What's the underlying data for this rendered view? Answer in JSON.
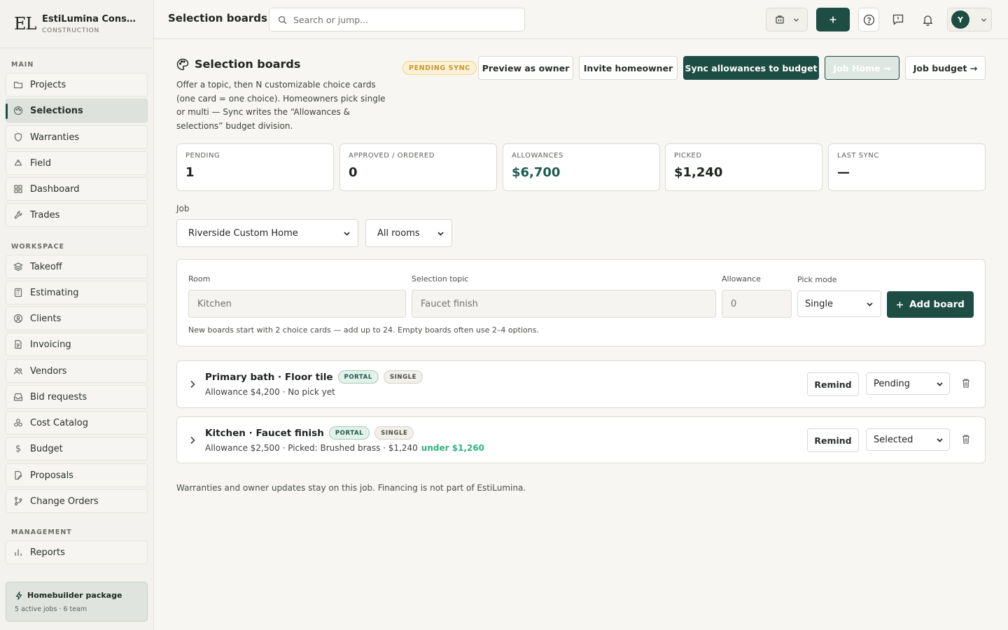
{
  "brand": {
    "mark": "EL",
    "name": "EstiLumina Constru...",
    "sub": "CONSTRUCTION"
  },
  "sidebar": {
    "sections": {
      "main": "MAIN",
      "workspace": "WORKSPACE",
      "management": "MANAGEMENT"
    },
    "items": [
      {
        "label": "Projects",
        "icon": "folder-icon"
      },
      {
        "label": "Selections",
        "icon": "palette-icon",
        "active": true
      },
      {
        "label": "Warranties",
        "icon": "shield-icon"
      },
      {
        "label": "Field",
        "icon": "hardhat-icon"
      },
      {
        "label": "Dashboard",
        "icon": "grid-icon"
      },
      {
        "label": "Trades",
        "icon": "wrench-icon"
      },
      {
        "label": "Takeoff",
        "icon": "layers-icon"
      },
      {
        "label": "Estimating",
        "icon": "calculator-icon"
      },
      {
        "label": "Clients",
        "icon": "user-circle-icon"
      },
      {
        "label": "Invoicing",
        "icon": "document-icon"
      },
      {
        "label": "Vendors",
        "icon": "users-icon"
      },
      {
        "label": "Bid requests",
        "icon": "inbox-icon"
      },
      {
        "label": "Cost Catalog",
        "icon": "boxes-icon"
      },
      {
        "label": "Budget",
        "icon": "dollar-icon"
      },
      {
        "label": "Proposals",
        "icon": "file-edit-icon"
      },
      {
        "label": "Change Orders",
        "icon": "git-branch-icon"
      },
      {
        "label": "Reports",
        "icon": "bar-chart-icon"
      }
    ],
    "package": {
      "title": "Homebuilder package",
      "sub": "5 active jobs · 6 team"
    }
  },
  "topbar": {
    "title": "Selection boards",
    "search_placeholder": "Search or jump...",
    "avatar_initial": "Y"
  },
  "page": {
    "title": "Selection boards",
    "description": "Offer a topic, then N customizable choice cards (one card = one choice). Homeowners pick single or multi — Sync writes the “Allowances & selections” budget division.",
    "sync_badge": "PENDING SYNC",
    "buttons": {
      "preview": "Preview as owner",
      "invite": "Invite homeowner",
      "sync": "Sync allowances to budget",
      "job_home": "Job Home →",
      "job_budget": "Job budget →"
    }
  },
  "stats": [
    {
      "label": "PENDING",
      "value": "1"
    },
    {
      "label": "APPROVED / ORDERED",
      "value": "0"
    },
    {
      "label": "ALLOWANCES",
      "value": "$6,700"
    },
    {
      "label": "PICKED",
      "value": "$1,240"
    },
    {
      "label": "LAST SYNC",
      "value": "—"
    }
  ],
  "filters": {
    "job_label": "Job",
    "job_value": "Riverside Custom Home",
    "room_value": "All rooms"
  },
  "form": {
    "room_label": "Room",
    "room_placeholder": "Kitchen",
    "topic_label": "Selection topic",
    "topic_placeholder": "Faucet finish",
    "allowance_label": "Allowance",
    "allowance_placeholder": "0",
    "pick_label": "Pick mode",
    "pick_value": "Single",
    "add_label": "Add board",
    "help": "New boards start with 2 choice cards — add up to 24. Empty boards often use 2–4 options."
  },
  "boards": [
    {
      "title": "Primary bath · Floor tile",
      "portal": "PORTAL",
      "mode": "SINGLE",
      "sub": "Allowance $4,200 · No pick yet",
      "under": "",
      "remind": "Remind",
      "status": "Pending"
    },
    {
      "title": "Kitchen · Faucet finish",
      "portal": "PORTAL",
      "mode": "SINGLE",
      "sub": "Allowance $2,500 · Picked: Brushed brass · $1,240",
      "under": "under $1,260",
      "remind": "Remind",
      "status": "Selected"
    }
  ],
  "footer_note": "Warranties and owner updates stay on this job. Financing is not part of EstiLumina.",
  "colors": {
    "accent": "#1d4d43",
    "positive": "#2fb380",
    "warning": "#c9962c"
  }
}
